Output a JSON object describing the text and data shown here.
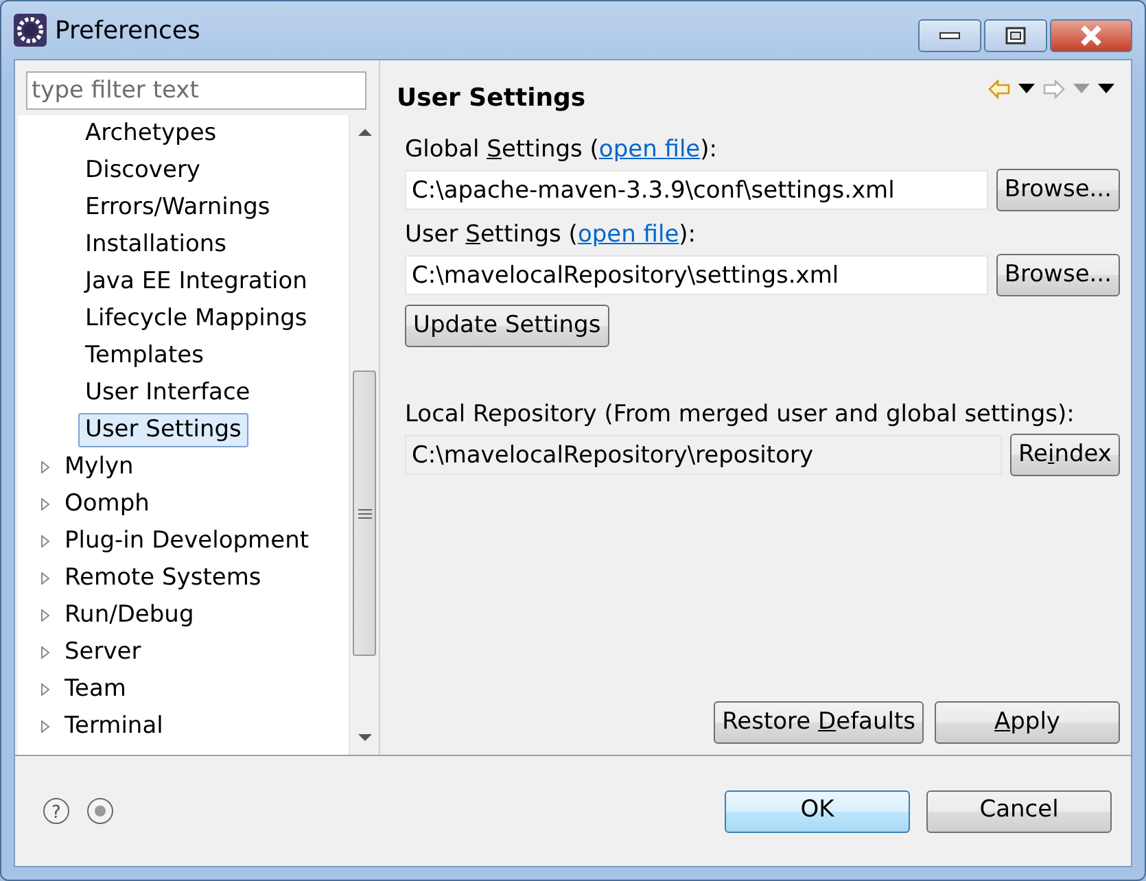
{
  "window": {
    "title": "Preferences"
  },
  "filter": {
    "placeholder": "type filter text"
  },
  "tree": {
    "visible_children_of_scrolled_parent": [
      {
        "label": "Archetypes",
        "selected": false
      },
      {
        "label": "Discovery",
        "selected": false
      },
      {
        "label": "Errors/Warnings",
        "selected": false
      },
      {
        "label": "Installations",
        "selected": false
      },
      {
        "label": "Java EE Integration",
        "selected": false
      },
      {
        "label": "Lifecycle Mappings",
        "selected": false
      },
      {
        "label": "Templates",
        "selected": false
      },
      {
        "label": "User Interface",
        "selected": false
      },
      {
        "label": "User Settings",
        "selected": true
      }
    ],
    "items": [
      {
        "label": "Mylyn",
        "selected": false,
        "expanded": false
      },
      {
        "label": "Oomph",
        "selected": false,
        "expanded": false
      },
      {
        "label": "Plug-in Development",
        "selected": false,
        "expanded": false
      },
      {
        "label": "Remote Systems",
        "selected": false,
        "expanded": false
      },
      {
        "label": "Run/Debug",
        "selected": false,
        "expanded": false
      },
      {
        "label": "Server",
        "selected": false,
        "expanded": false
      },
      {
        "label": "Team",
        "selected": false,
        "expanded": false
      },
      {
        "label": "Terminal",
        "selected": false,
        "expanded": false
      }
    ]
  },
  "page": {
    "title": "User Settings",
    "fields": [
      {
        "label_parts": {
          "before": "Global ",
          "underlined": "S",
          "after": "ettings ("
        },
        "link": "open file",
        "label_after": "):",
        "value": "C:\\apache-maven-3.3.9\\conf\\settings.xml",
        "readonly": false,
        "button": {
          "label": "Browse..."
        }
      },
      {
        "label_parts": {
          "before": "User ",
          "underlined": "S",
          "after": "ettings ("
        },
        "link": "open file",
        "label_after": "):",
        "value": "C:\\mavelocalRepository\\settings.xml",
        "readonly": false,
        "button": {
          "label": "Browse..."
        }
      }
    ],
    "update_button": {
      "label": "Update Settings"
    },
    "local_repository": {
      "label": "Local Repository (From merged user and global settings):",
      "value": "C:\\mavelocalRepository\\repository",
      "readonly": true,
      "button": {
        "label_parts": {
          "before": "Re",
          "underlined": "i",
          "after": "ndex"
        }
      }
    },
    "buttons": [
      {
        "label_parts": {
          "before": "Restore ",
          "underlined": "D",
          "after": "efaults"
        }
      },
      {
        "label_parts": {
          "underlined": "A",
          "after": "pply"
        }
      }
    ]
  },
  "footer": {
    "help_glyph": "?"
  },
  "dialog_buttons": [
    {
      "label": "OK",
      "default": true
    },
    {
      "label": "Cancel",
      "default": false
    }
  ]
}
